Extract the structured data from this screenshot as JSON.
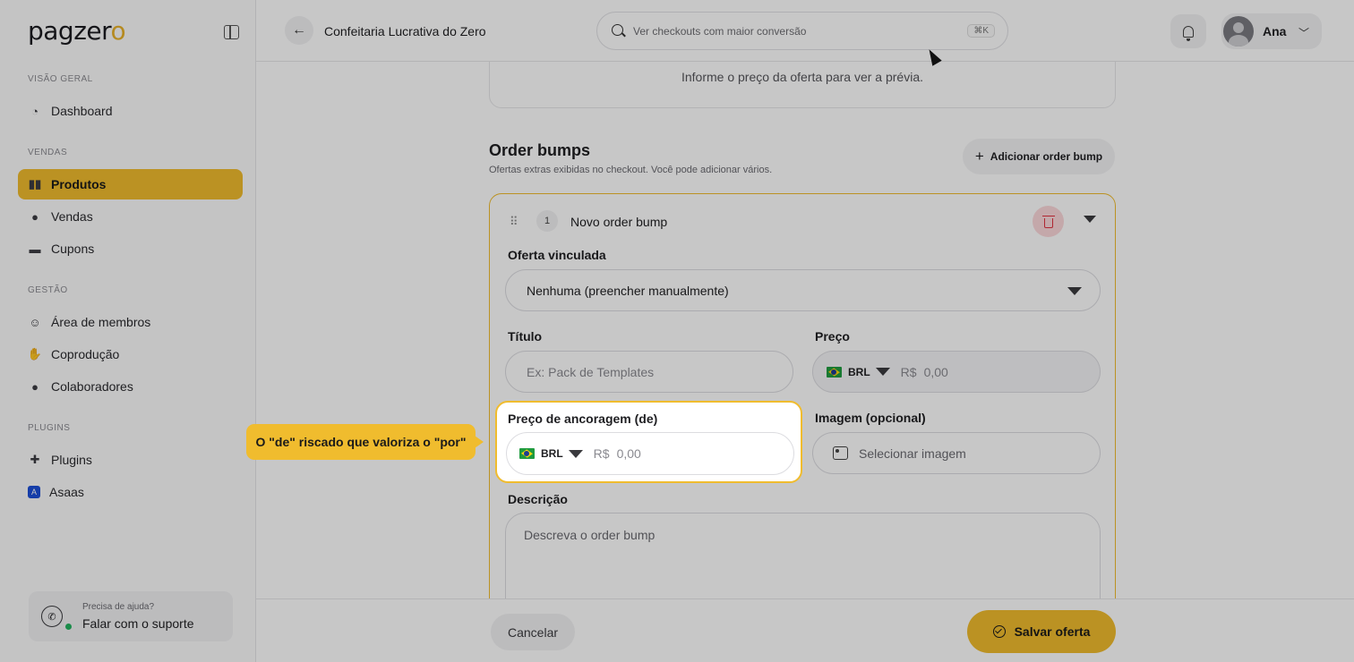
{
  "brand": {
    "logo_main": "pagzer",
    "logo_accent": "o"
  },
  "sidebar": {
    "sections": [
      {
        "label": "VISÃO GERAL"
      },
      {
        "label": "VENDAS"
      },
      {
        "label": "GESTÃO"
      },
      {
        "label": "PLUGINS"
      }
    ],
    "items": [
      {
        "label": "Dashboard",
        "icon": "dashboard-icon"
      },
      {
        "label": "Produtos",
        "icon": "products-icon",
        "active": true
      },
      {
        "label": "Vendas",
        "icon": "sales-icon"
      },
      {
        "label": "Cupons",
        "icon": "coupon-icon"
      },
      {
        "label": "Área de membros",
        "icon": "members-icon"
      },
      {
        "label": "Coprodução",
        "icon": "handshake-icon"
      },
      {
        "label": "Colaboradores",
        "icon": "user-icon"
      },
      {
        "label": "Plugins",
        "icon": "puzzle-icon"
      },
      {
        "label": "Asaas",
        "icon": "asaas-icon"
      }
    ],
    "help": {
      "small": "Precisa de ajuda?",
      "big": "Falar com o suporte"
    }
  },
  "topbar": {
    "title": "Confeitaria Lucrativa do Zero",
    "search_placeholder": "Ver checkouts com maior conversão",
    "search_shortcut": "⌘K",
    "user_name": "Ana"
  },
  "main": {
    "preview_text": "Informe o preço da oferta para ver a prévia.",
    "order_bumps_title": "Order bumps",
    "order_bumps_subtitle": "Ofertas extras exibidas no checkout. Você pode adicionar vários.",
    "add_button": "Adicionar order bump",
    "card": {
      "number": "1",
      "name": "Novo order bump",
      "linked_offer_label": "Oferta vinculada",
      "linked_offer_value": "Nenhuma (preencher manualmente)",
      "title_label": "Título",
      "title_placeholder": "Ex: Pack de Templates",
      "price_label": "Preço",
      "currency": "BRL",
      "currency_symbol": "R$",
      "price_placeholder": "0,00",
      "anchor_label": "Preço de ancoragem (de)",
      "anchor_placeholder": "0,00",
      "image_label": "Imagem (opcional)",
      "image_placeholder": "Selecionar imagem",
      "description_label": "Descrição",
      "description_placeholder": "Descreva o order bump"
    }
  },
  "footer": {
    "cancel": "Cancelar",
    "save": "Salvar oferta"
  },
  "tooltip": {
    "text": "O \"de\" riscado que valoriza o \"por\""
  },
  "colors": {
    "accent": "#f0bc2e",
    "danger": "#e03341"
  }
}
